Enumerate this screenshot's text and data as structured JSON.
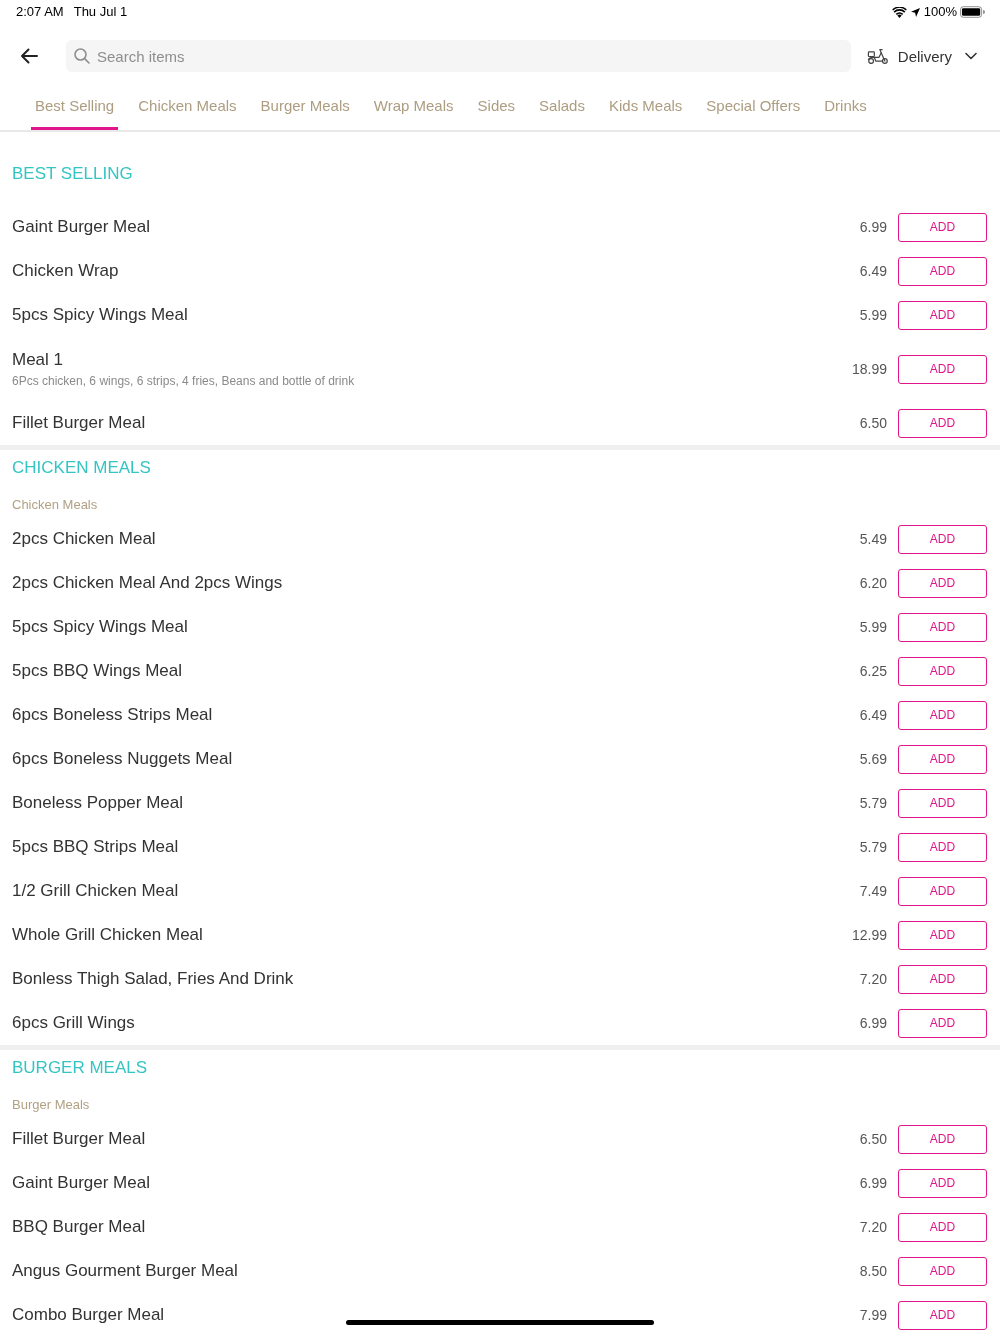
{
  "status_bar": {
    "time": "2:07 AM",
    "date": "Thu Jul 1",
    "battery": "100%"
  },
  "search": {
    "placeholder": "Search items"
  },
  "order_mode": {
    "label": "Delivery"
  },
  "tabs": [
    {
      "label": "Best Selling",
      "selected": true
    },
    {
      "label": "Chicken Meals",
      "selected": false
    },
    {
      "label": "Burger Meals",
      "selected": false
    },
    {
      "label": "Wrap Meals",
      "selected": false
    },
    {
      "label": "Sides",
      "selected": false
    },
    {
      "label": "Salads",
      "selected": false
    },
    {
      "label": "Kids Meals",
      "selected": false
    },
    {
      "label": "Special Offers",
      "selected": false
    },
    {
      "label": "Drinks",
      "selected": false
    }
  ],
  "sections": [
    {
      "title": "BEST SELLING",
      "items": [
        {
          "name": "Gaint Burger Meal",
          "price": "6.99",
          "action": "ADD"
        },
        {
          "name": "Chicken Wrap",
          "price": "6.49",
          "action": "ADD"
        },
        {
          "name": "5pcs Spicy Wings Meal",
          "price": "5.99",
          "action": "ADD"
        },
        {
          "name": "Meal 1",
          "description": "6Pcs chicken, 6 wings, 6 strips, 4 fries, Beans and bottle of drink",
          "price": "18.99",
          "action": "ADD"
        },
        {
          "name": "Fillet Burger Meal",
          "price": "6.50",
          "action": "ADD"
        }
      ]
    },
    {
      "title": "CHICKEN MEALS",
      "subtitle": "Chicken Meals",
      "items": [
        {
          "name": "2pcs Chicken Meal",
          "price": "5.49",
          "action": "ADD"
        },
        {
          "name": "2pcs Chicken Meal And 2pcs Wings",
          "price": "6.20",
          "action": "ADD"
        },
        {
          "name": "5pcs Spicy Wings Meal",
          "price": "5.99",
          "action": "ADD"
        },
        {
          "name": "5pcs BBQ Wings Meal",
          "price": "6.25",
          "action": "ADD"
        },
        {
          "name": "6pcs Boneless Strips Meal",
          "price": "6.49",
          "action": "ADD"
        },
        {
          "name": "6pcs Boneless Nuggets Meal",
          "price": "5.69",
          "action": "ADD"
        },
        {
          "name": "Boneless Popper Meal",
          "price": "5.79",
          "action": "ADD"
        },
        {
          "name": "5pcs BBQ Strips Meal",
          "price": "5.79",
          "action": "ADD"
        },
        {
          "name": "1/2 Grill Chicken Meal",
          "price": "7.49",
          "action": "ADD"
        },
        {
          "name": "Whole Grill Chicken Meal",
          "price": "12.99",
          "action": "ADD"
        },
        {
          "name": "Bonless Thigh Salad, Fries And Drink",
          "price": "7.20",
          "action": "ADD"
        },
        {
          "name": "6pcs Grill Wings",
          "price": "6.99",
          "action": "ADD"
        }
      ]
    },
    {
      "title": "BURGER MEALS",
      "subtitle": "Burger Meals",
      "items": [
        {
          "name": "Fillet Burger Meal",
          "price": "6.50",
          "action": "ADD"
        },
        {
          "name": "Gaint Burger Meal",
          "price": "6.99",
          "action": "ADD"
        },
        {
          "name": "BBQ Burger Meal",
          "price": "7.20",
          "action": "ADD"
        },
        {
          "name": "Angus Gourment Burger Meal",
          "price": "8.50",
          "action": "ADD"
        },
        {
          "name": "Combo Burger Meal",
          "price": "7.99",
          "action": "ADD"
        }
      ]
    }
  ]
}
